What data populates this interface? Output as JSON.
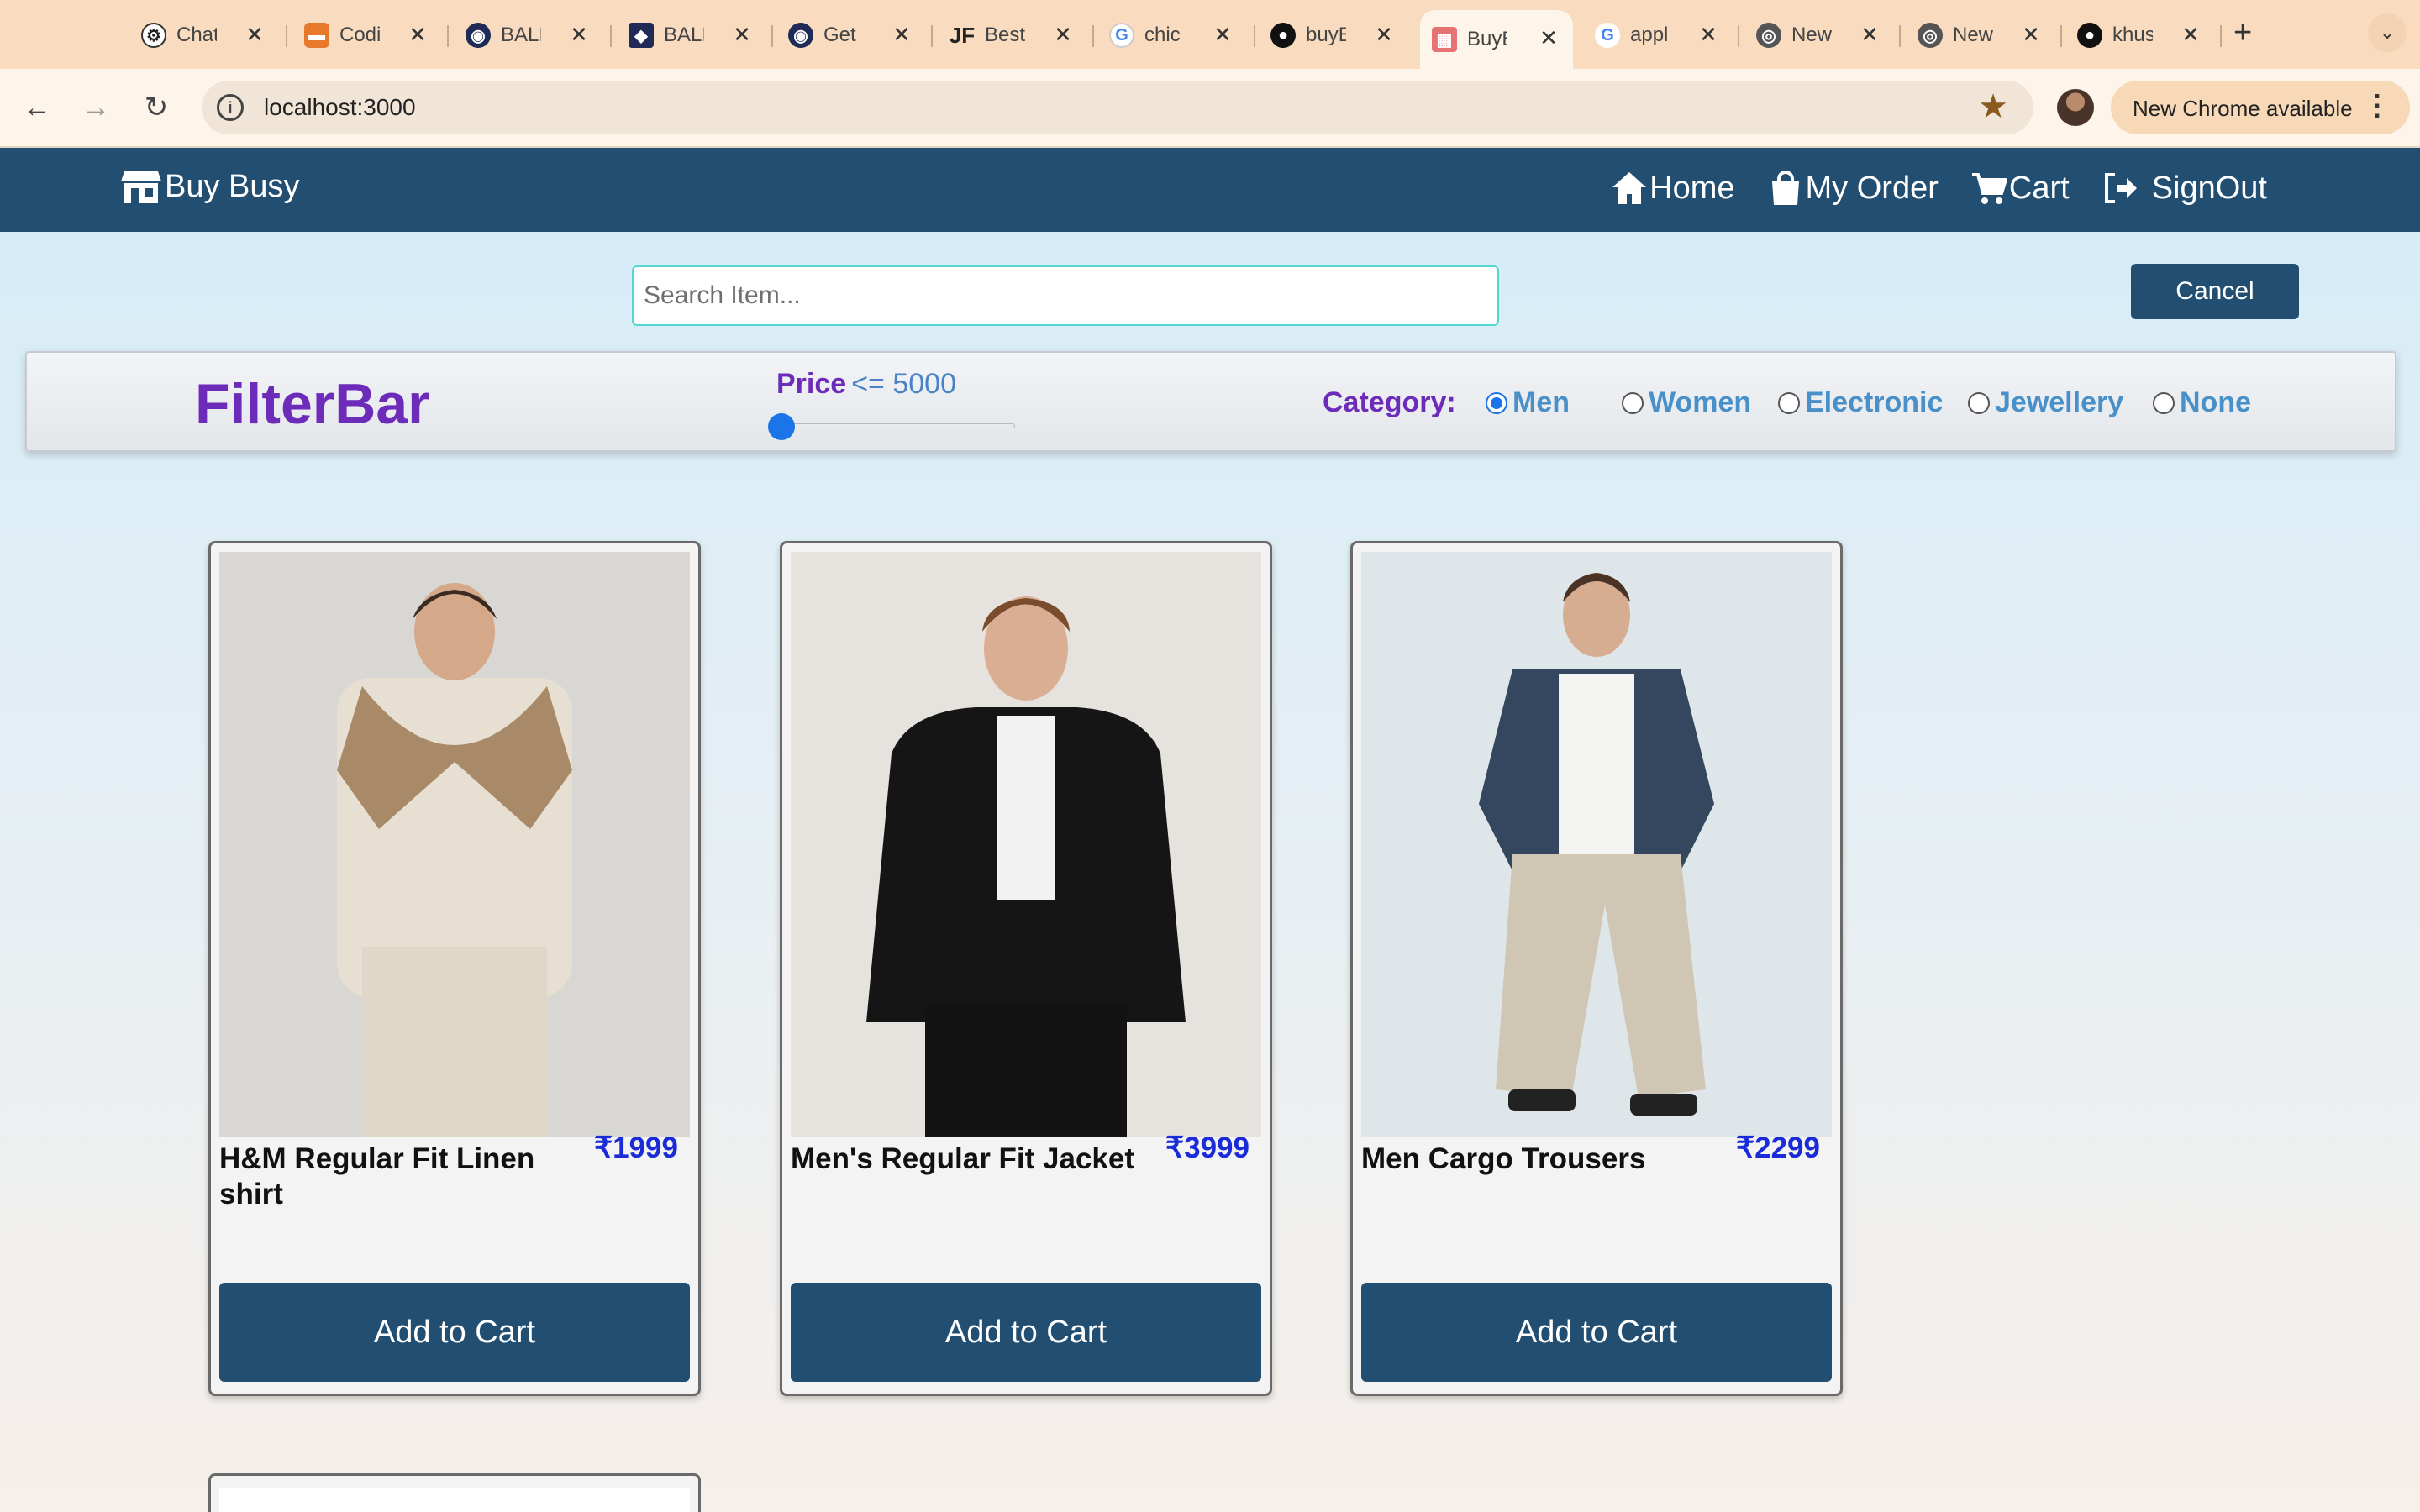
{
  "browser": {
    "tabs": [
      {
        "title": "ChatGPT",
        "icon": "openai-icon",
        "color": "#ffffff"
      },
      {
        "title": "Coding Ninjas",
        "icon": "codingninjas-icon",
        "color": "#e8782a"
      },
      {
        "title": "BALI",
        "icon": "bali-icon",
        "color": "#1f2a56"
      },
      {
        "title": "BALI",
        "icon": "bali-icon",
        "color": "#1f2a56"
      },
      {
        "title": "Get",
        "icon": "bali-icon",
        "color": "#1f2a56"
      },
      {
        "title": "Best",
        "icon": "jf-icon",
        "color": "#222222"
      },
      {
        "title": "chic",
        "icon": "google-icon",
        "color": "#4285f4"
      },
      {
        "title": "buyBusy",
        "icon": "github-icon",
        "color": "#111111"
      },
      {
        "title": "BuyBusy",
        "icon": "store-icon",
        "color": "#e57373"
      },
      {
        "title": "appl",
        "icon": "google-icon",
        "color": "#4285f4"
      },
      {
        "title": "New",
        "icon": "chrome-icon",
        "color": "#555555"
      },
      {
        "title": "New",
        "icon": "chrome-icon",
        "color": "#555555"
      },
      {
        "title": "khus",
        "icon": "github-icon",
        "color": "#111111"
      }
    ],
    "active_tab_index": 8,
    "new_tab_label": "+",
    "url": "localhost:3000",
    "update_label": "New Chrome available"
  },
  "app": {
    "brand": "Buy Busy",
    "nav": {
      "home": "Home",
      "orders": "My Order",
      "cart": "Cart",
      "signout": "SignOut"
    },
    "search": {
      "placeholder": "Search Item...",
      "value": ""
    },
    "cancel_label": "Cancel",
    "filter": {
      "title": "FilterBar",
      "price_label": "Price",
      "price_op": "<= 5000",
      "price_value": 5000,
      "price_slider_fraction": 0.05,
      "category_label": "Category:",
      "categories": [
        "Men",
        "Women",
        "Electronic",
        "Jewellery",
        "None"
      ],
      "selected_category": "Men"
    },
    "products": [
      {
        "name": "H&M Regular Fit Linen shirt",
        "price": "₹1999",
        "button": "Add to Cart"
      },
      {
        "name": "Men's Regular Fit Jacket",
        "price": "₹3999",
        "button": "Add to Cart"
      },
      {
        "name": "Men Cargo Trousers",
        "price": "₹2299",
        "button": "Add to Cart"
      }
    ]
  }
}
